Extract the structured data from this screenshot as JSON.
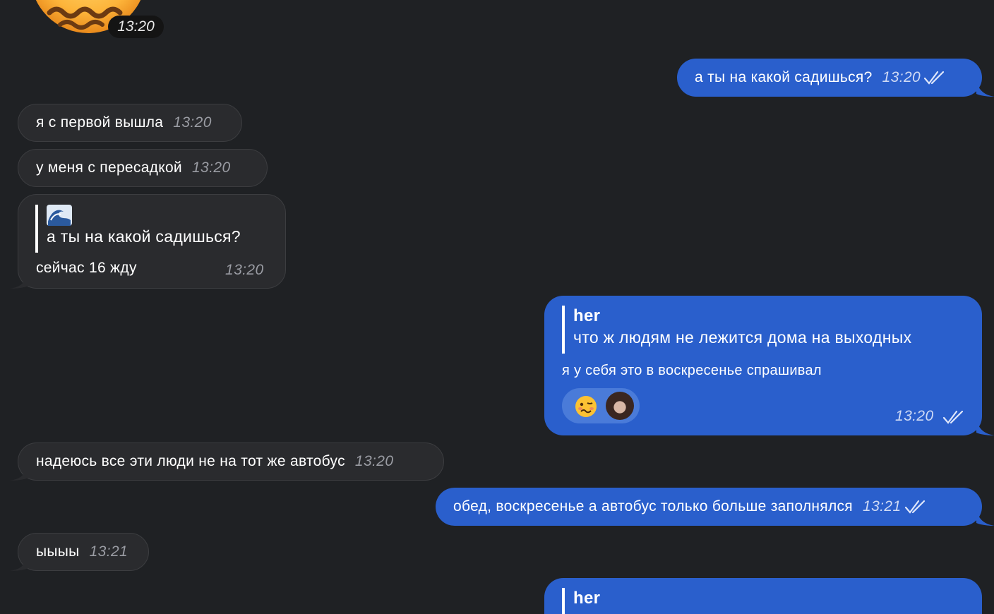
{
  "theme": {
    "background": "#1f2124",
    "incoming_bubble": "#2a2b2e",
    "outgoing_bubble": "#2a5fcc",
    "reaction_pill": "#4a7bd9"
  },
  "sticker": {
    "time": "13:20",
    "icon": "sad-face-sticker"
  },
  "messages": [
    {
      "id": "m1",
      "direction": "out",
      "text": "а ты на какой садишься?",
      "time": "13:20",
      "status": "read"
    },
    {
      "id": "m2",
      "direction": "in",
      "text": "я с первой вышла",
      "time": "13:20"
    },
    {
      "id": "m3",
      "direction": "in",
      "text": "у меня с пересадкой",
      "time": "13:20"
    },
    {
      "id": "m4",
      "direction": "in",
      "reply": {
        "title_icon": "wave-emoji",
        "text": "а ты на какой садишься?"
      },
      "text": "сейчас 16 жду",
      "time": "13:20"
    },
    {
      "id": "m5",
      "direction": "out",
      "reply": {
        "title": "her",
        "text": "что ж людям не лежится дома на выходных"
      },
      "text": "я у себя это в воскресенье спрашивал",
      "time": "13:20",
      "status": "read",
      "reactions": [
        "woozy-face-emoji",
        "reactor-avatar"
      ]
    },
    {
      "id": "m6",
      "direction": "in",
      "text": "надеюсь все эти люди не на тот же автобус",
      "time": "13:20"
    },
    {
      "id": "m7",
      "direction": "out",
      "text": "обед, воскресенье а автобус только больше заполнялся",
      "time": "13:21",
      "status": "read"
    },
    {
      "id": "m8",
      "direction": "in",
      "text": "ыыыы",
      "time": "13:21"
    },
    {
      "id": "m9",
      "direction": "out",
      "reply": {
        "title": "her"
      }
    }
  ]
}
